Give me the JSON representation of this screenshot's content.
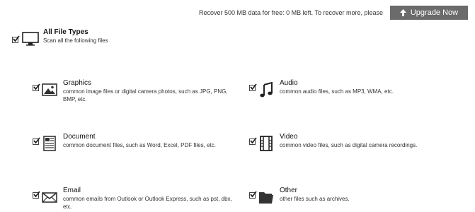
{
  "topbar": {
    "recover_text": "Recover 500 MB data for free: 0 MB left. To recover more, please",
    "upgrade_label": "Upgrade Now"
  },
  "all_file_types": {
    "checked": true,
    "title": "All File Types",
    "description": "Scan all the following files"
  },
  "categories": [
    {
      "title": "Graphics",
      "description": "common image files or digital camera photos, such as JPG, PNG, BMP, etc.",
      "icon": "image-icon",
      "checked": true
    },
    {
      "title": "Audio",
      "description": "common audio files, such as MP3, WMA, etc.",
      "icon": "music-note-icon",
      "checked": true
    },
    {
      "title": "Document",
      "description": "common document files, such as Word, Excel, PDF files, etc.",
      "icon": "document-icon",
      "checked": true
    },
    {
      "title": "Video",
      "description": "common video files, such as digital camera recordings.",
      "icon": "film-icon",
      "checked": true
    },
    {
      "title": "Email",
      "description": "common emails from Outlook or Outlook Express, such as pst, dbx, etc.",
      "icon": "envelope-icon",
      "checked": true
    },
    {
      "title": "Other",
      "description": "other files such as archives.",
      "icon": "folder-icon",
      "checked": true
    }
  ]
}
